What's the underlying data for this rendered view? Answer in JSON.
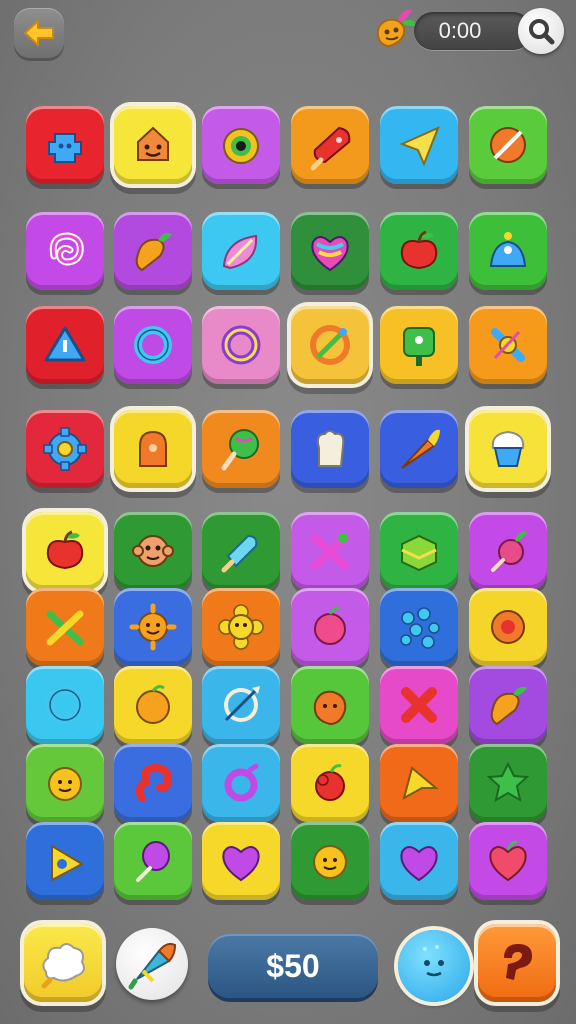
{
  "header": {
    "timer": "0:00",
    "back_icon": "arrow-left-icon",
    "boost_icon": "carrot-booster-icon",
    "search_icon": "magnifier-icon"
  },
  "board": {
    "rows": [
      [
        {
          "color": "#e8242e",
          "icon": "puzzle-robot"
        },
        {
          "color": "#f6e63a",
          "icon": "smiling-face",
          "framed": true
        },
        {
          "color": "#c45ae8",
          "icon": "eye-monster"
        },
        {
          "color": "#f39a1d",
          "icon": "popsicle"
        },
        {
          "color": "#34b6f0",
          "icon": "paper-plane"
        },
        {
          "color": "#5acb3a",
          "icon": "sliced-ball"
        }
      ],
      [
        {
          "color": "#c44ae8",
          "icon": "swirl"
        },
        {
          "color": "#b34ae0",
          "icon": "carrot"
        },
        {
          "color": "#3cc8f0",
          "icon": "leaf"
        },
        {
          "color": "#2f8f3a",
          "icon": "rainbow-heart"
        },
        {
          "color": "#2fb443",
          "icon": "apple"
        },
        {
          "color": "#3dbf3a",
          "icon": "alarm-bot"
        }
      ],
      [
        {
          "color": "#e0202a",
          "icon": "warning-triangle"
        },
        {
          "color": "#c04ae6",
          "icon": "ring"
        },
        {
          "color": "#e889c8",
          "icon": "rainbow-ring"
        },
        {
          "color": "#f4c33a",
          "icon": "swirl-rocket",
          "framed": true
        },
        {
          "color": "#f7c126",
          "icon": "green-sign"
        },
        {
          "color": "#f59a1a",
          "icon": "gadget"
        }
      ],
      [
        {
          "color": "#e2283a",
          "icon": "gear"
        },
        {
          "color": "#f5d72a",
          "icon": "bell-house",
          "framed": true
        },
        {
          "color": "#f08a1e",
          "icon": "lollipop"
        },
        {
          "color": "#3a5ee0",
          "icon": "popcorn"
        },
        {
          "color": "#3a5ee0",
          "icon": "carrot-rocket"
        },
        {
          "color": "#f7e23a",
          "icon": "cupcake",
          "framed": true
        }
      ],
      [
        {
          "color": "#f6e63a",
          "icon": "apple",
          "framed": true
        },
        {
          "color": "#2f9a33",
          "icon": "monkey-face"
        },
        {
          "color": "#2f9a33",
          "icon": "ice-pop"
        },
        {
          "color": "#c45ae8",
          "icon": "candy-x"
        },
        {
          "color": "#2fb443",
          "icon": "cake-block"
        },
        {
          "color": "#c44ae8",
          "icon": "radish"
        }
      ],
      [
        {
          "color": "#f07a1a",
          "icon": "crossed-sticks"
        },
        {
          "color": "#3a6ee0",
          "icon": "sun-face"
        },
        {
          "color": "#f07a1a",
          "icon": "flower-face"
        },
        {
          "color": "#c45ae8",
          "icon": "peach"
        },
        {
          "color": "#2f6fdc",
          "icon": "dots"
        },
        {
          "color": "#f6d52a",
          "icon": "cog-flower"
        }
      ],
      [
        {
          "color": "#3ac8f0",
          "icon": "ring"
        },
        {
          "color": "#f6d82a",
          "icon": "orange"
        },
        {
          "color": "#3ab6ea",
          "icon": "bow"
        },
        {
          "color": "#56c63a",
          "icon": "tomato"
        },
        {
          "color": "#e64ac8",
          "icon": "x-mark"
        },
        {
          "color": "#a34ae0",
          "icon": "carrot"
        }
      ],
      [
        {
          "color": "#64c83a",
          "icon": "lemon-face"
        },
        {
          "color": "#3a6ee0",
          "icon": "hook"
        },
        {
          "color": "#3ab6ea",
          "icon": "ring-swirl"
        },
        {
          "color": "#f6d82a",
          "icon": "berry"
        },
        {
          "color": "#f06a1a",
          "icon": "arrow-cursor"
        },
        {
          "color": "#2f9a33",
          "icon": "star"
        }
      ],
      [
        {
          "color": "#2f6fdc",
          "icon": "donut-triangle"
        },
        {
          "color": "#5ac83a",
          "icon": "balloon"
        },
        {
          "color": "#f6d82a",
          "icon": "heart"
        },
        {
          "color": "#2f9a33",
          "icon": "lemon-face"
        },
        {
          "color": "#3ab6ea",
          "icon": "heart"
        },
        {
          "color": "#c44ae8",
          "icon": "apple-heart"
        }
      ]
    ]
  },
  "footer": {
    "money": "$50",
    "btn1_icon": "cloud-puff-icon",
    "btn2_icon": "rocket-cone-icon",
    "btn3_icon": "blue-monster-icon",
    "btn4_icon": "question-swirl-icon"
  },
  "colors": {
    "background": "#7b7b7b",
    "money_pill": "#2c5683",
    "tile_frame": "#f4eedc"
  }
}
